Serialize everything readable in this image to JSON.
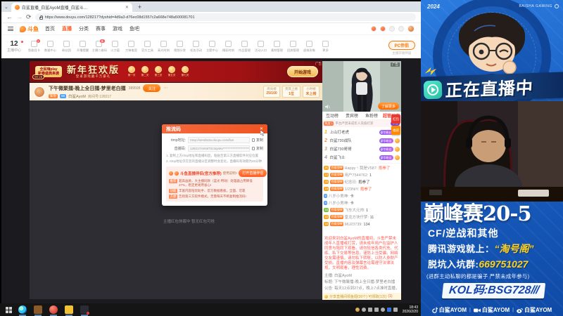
{
  "browser": {
    "dropdown_glyph": "⌄",
    "tab_title": "白鲨直播_白鲨AyoM直播_白鲨斗…",
    "tab_close": "✕",
    "new_tab": "+",
    "back": "←",
    "forward": "→",
    "reload": "⟳",
    "url": "https://www.douyu.com/128217?dyshid=4d9a3-d76ec08d1557c2a668e748a500081701"
  },
  "nav": {
    "logo_text": "斗鱼",
    "items": [
      {
        "label": "首页"
      },
      {
        "label": "直播",
        "cls": "active"
      },
      {
        "label": "分类"
      },
      {
        "label": "赛事"
      },
      {
        "label": "游戏"
      },
      {
        "label": "鱼吧"
      }
    ]
  },
  "toolbar": {
    "level": "12",
    "level_label": "主播中心",
    "tools": [
      {
        "label": "鱼翅月卡",
        "badge": "5"
      },
      {
        "label": "数据中心"
      },
      {
        "label": "粉丝团"
      },
      {
        "label": "开播提醒"
      },
      {
        "label": "主播二维码",
        "badge": "新"
      },
      {
        "label": "火力值"
      },
      {
        "label": "刀锋电竞"
      },
      {
        "label": "官方工具"
      },
      {
        "label": "高光时刻"
      },
      {
        "label": "视频分发"
      },
      {
        "label": "任务活动"
      },
      {
        "label": "主题中心"
      },
      {
        "label": "精彩时刻"
      },
      {
        "label": "作品管理"
      },
      {
        "label": "活动入口"
      },
      {
        "label": "素材管理"
      },
      {
        "label": "回放管理"
      },
      {
        "label": "虚拟形象"
      },
      {
        "label": "更多"
      }
    ],
    "pc_button": "PC伴侣",
    "pc_sub": "主播开播神器"
  },
  "banner": {
    "ad_tag": "广告",
    "left_line1": "全民嗨play",
    "left_line2": "新春盛典来袭",
    "countdown": "00:28",
    "title": "新年狂欢版",
    "subtitle": "登录游戏赢千万豪礼",
    "stages": [
      {
        "t": "第一关",
        "s": "抽豪礼"
      },
      {
        "t": "第二关",
        "s": "领红包"
      },
      {
        "t": "第三关",
        "s": "赢金币"
      },
      {
        "t": "第五关",
        "s": "拿福袋"
      },
      {
        "t": "第七关",
        "s": "得大奖"
      }
    ],
    "button": "开始游戏"
  },
  "room": {
    "title": "下午微聚擂-晚上全日擂-梦里老白擂",
    "views": "389508",
    "follow": "关注",
    "more": "⋯",
    "fan_badge": "鲨鱼",
    "level_badge": "68",
    "anchor": "白鲨AyoM",
    "room_no": "房间号:128217",
    "stats": [
      {
        "t": "周贡榜",
        "v": "25/100"
      },
      {
        "t": "贵宾上榜",
        "v": "1位"
      },
      {
        "t": "小时榜",
        "v": "未上榜"
      }
    ]
  },
  "dialog": {
    "title": "推流码",
    "close": "✕",
    "rtmp_label": "rtmp地址:",
    "rtmp_value": "rtmp://sendtx3a.douyu.com/live",
    "copy": "复制",
    "code_label": "直播码:",
    "code_value": "128217rmN8T0z3qvMv**********************wsvbr5v8znwczgrv",
    "note1": "1. 复制上方rtmp地址和直播码后，粘贴至第三方直播软件对应位置",
    "note2": "2. rtmp地址仅在您的直播分区调整时会变化，直播码有效期为45分钟",
    "promo_title": "斗鱼直播伴侣(官方推荐)",
    "promo_link": "使用说明>",
    "promo_button": "打开直播伴侣",
    "bullets": [
      {
        "tag": "推荐",
        "text": "超高画质，大主播同款（蓝光 特效）处理器占用降低27%，稳定更易用省心!"
      },
      {
        "tag": "功能",
        "text": "丰富内容陪玩助手、官方数据看板，全面、可靠"
      },
      {
        "tag": "方便",
        "text": "告别第三方软件模式，无需每天不断复制推流码!"
      }
    ]
  },
  "video_note": "主播红包休眠中 暂无红包可抢",
  "sidebar": {
    "ad_tag": "广告",
    "ad_button": "了解更多",
    "tabs": [
      {
        "label": "互动榜"
      },
      {
        "label": "贵宾榜"
      },
      {
        "label": "鱼粉榜"
      },
      {
        "label": "超管动态",
        "cls": "active"
      }
    ],
    "notice_badge": "热度 1",
    "notice": "平台严禁未成年人充值打赏",
    "notice_pill": "举报",
    "ranks": [
      {
        "pos": "1",
        "name": "上山打老虎",
        "pill": "豪华粉丝",
        "color": "#f7b500"
      },
      {
        "pos": "2",
        "name": "白鲨730战队",
        "pill": "豪华粉丝",
        "color": "#ff8a3c"
      },
      {
        "pos": "3",
        "name": "白鲨730哥哥",
        "pill": "豪华粉丝",
        "color": "#c9a36a"
      },
      {
        "pos": "4",
        "name": "白鲨飞士",
        "pill": "豪华粉丝",
        "color": "#9b9b9b"
      }
    ],
    "chat": [
      {
        "level": "21",
        "lc": "#f5a623",
        "fan": "白鲨战神",
        "name": "Happy丶我是V587",
        "msg": "抱拳了",
        "cls": "red"
      },
      {
        "level": "13",
        "lc": "#f5a623",
        "fan": "白鲨战神",
        "name": "用户7544762",
        "msg": "1"
      },
      {
        "level": "25",
        "lc": "#f5a623",
        "fan": "白鲨战神",
        "name": "纪念日",
        "msg": "抱拳了"
      },
      {
        "level": "19",
        "lc": "#f5a623",
        "fan": "白鲨战神",
        "name": "1/23NiY",
        "msg": "抱拳了",
        "cls": "red"
      },
      {
        "level": "8",
        "lc": "#5b9ff0",
        "name": "八岁小男神",
        "msg": "卡"
      },
      {
        "level": "8",
        "lc": "#5b9ff0",
        "name": "八岁小男神",
        "msg": "卡"
      },
      {
        "level": "16",
        "lc": "#7ac143",
        "fan": "白鲨战神",
        "name": "飞车大元帅",
        "msg": "1"
      },
      {
        "level": "22",
        "lc": "#f5a623",
        "fan": "白鲨战神",
        "name": "皇龙方块仔梦",
        "msg": "11"
      },
      {
        "level": "18",
        "lc": "#f5a623",
        "fan": "白鲨战神",
        "name": "MU23739",
        "msg": "134"
      }
    ],
    "announcement": "欢迎来到白鲨AyoM的直播间，斗鱼严禁未成年人直播或打赏，请未成年用户在监护人同意与陪同下观看。请勿轻信各类代充、代练、私下交易等信息，谨防上当受骗。网络交友需谨慎，请勿私下转账，以防人身财产受损。直播内容及弹幕言论需遵守法律法规，文明观看，理性消费。",
    "info_anchor": "主播: 白鲨AyoM",
    "info_title": "标题: 下午微聚擂-晚上全日擂-梦里老白擂",
    "info_notice": "公告: 每天12点到27点，晚上7点准时直播，免费抽奖充值 随一送一，拒绝赌托不要私聊",
    "share_line": "分享直播间领鱼翅(30个) 可领取(1次)",
    "share_count": "(1)",
    "pendants": [
      {
        "label": "红包",
        "color": "#e8382f"
      },
      {
        "label": "福袋",
        "color": "#ff8a00"
      }
    ]
  },
  "taskbar": {
    "time": "18:43",
    "date": "2026/2/20"
  },
  "overlay": {
    "year": "2024",
    "brand": "BAISHA GAMING",
    "live": "正在直播中",
    "title": "巅峰赛20-5",
    "line1": "CF/逆战和其他",
    "line2_a": "腾讯游戏就上：",
    "line2_b": "“淘号阁”",
    "line3_a": "脱坑入坑群:",
    "line3_b": "669751027",
    "line4": "(进群主动私聊的都是骗子 严禁未成年参与)",
    "kol": "KOL码:BSG728",
    "kol_marks": "///",
    "socials": [
      {
        "label": "白鲨AYOM"
      },
      {
        "label": "白鲨AYOM"
      },
      {
        "label": "白鲨AYOM"
      }
    ]
  }
}
